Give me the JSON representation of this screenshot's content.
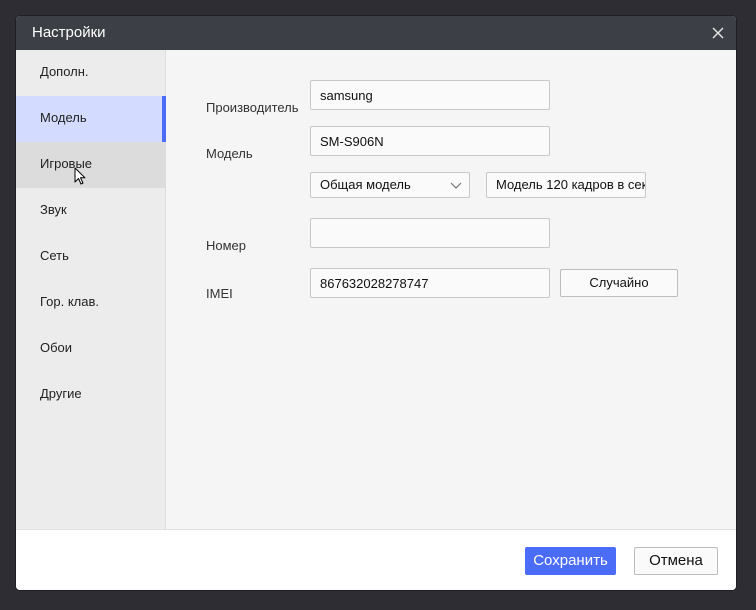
{
  "window": {
    "title": "Настройки"
  },
  "sidebar": {
    "items": [
      {
        "label": "Дополн."
      },
      {
        "label": "Модель"
      },
      {
        "label": "Игровые"
      },
      {
        "label": "Звук"
      },
      {
        "label": "Сеть"
      },
      {
        "label": "Гор. клав."
      },
      {
        "label": "Обои"
      },
      {
        "label": "Другие"
      }
    ],
    "active_index": 1,
    "hover_index": 2
  },
  "form": {
    "manufacturer_label": "Производитель",
    "manufacturer_value": "samsung",
    "model_label": "Модель",
    "model_value": "SM-S906N",
    "model_type_select": "Общая модель",
    "fps_select": "Модель 120 кадров в сек",
    "number_label": "Номер",
    "number_value": "",
    "imei_label": "IMEI",
    "imei_value": "867632028278747",
    "random_button": "Случайно"
  },
  "footer": {
    "save_label": "Сохранить",
    "cancel_label": "Отмена"
  },
  "colors": {
    "accent": "#4a6cf7",
    "titlebar": "#3d3f47",
    "active_item_bg": "#d3dcff"
  },
  "icons": {
    "close": "close-icon",
    "dropdown": "chevron-down-icon",
    "cursor": "mouse-pointer-icon"
  }
}
